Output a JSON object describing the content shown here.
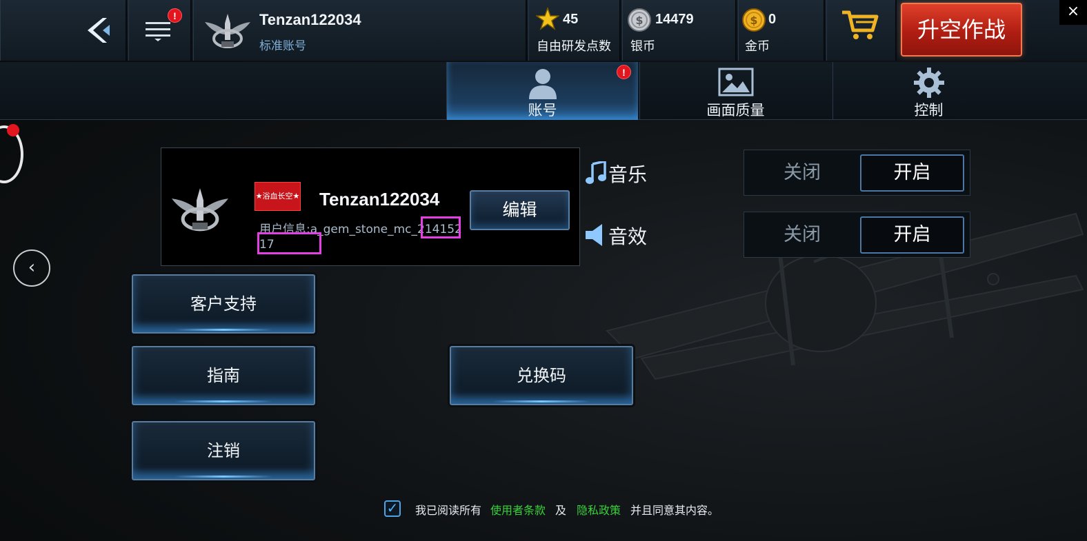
{
  "header": {
    "menu_badge": "!",
    "username": "Tenzan122034",
    "account_type": "标准账号",
    "research_points": {
      "value": "45",
      "label": "自由研发点数"
    },
    "silver": {
      "value": "14479",
      "label": "银币"
    },
    "gold": {
      "value": "0",
      "label": "金币"
    },
    "launch_button": "升空作战",
    "close": "×"
  },
  "tabs": [
    {
      "label": "账号",
      "badge": "!",
      "active": true
    },
    {
      "label": "画面质量",
      "active": false
    },
    {
      "label": "控制",
      "active": false
    }
  ],
  "profile": {
    "guild_tag": "★浴血长空★",
    "username": "Tenzan122034",
    "user_info": "用户信息:a_gem_stone_mc_21415217",
    "edit_button": "编辑"
  },
  "settings": {
    "music": {
      "label": "音乐",
      "off": "关闭",
      "on": "开启",
      "state": "on"
    },
    "sound_effects": {
      "label": "音效",
      "off": "关闭",
      "on": "开启",
      "state": "on"
    }
  },
  "buttons": {
    "support": "客户支持",
    "guide": "指南",
    "redeem": "兑换码",
    "logout": "注销"
  },
  "footer": {
    "checked": true,
    "text_before": "我已阅读所有",
    "terms_link": "使用者条款",
    "and": "及",
    "privacy_link": "隐私政策",
    "text_after": "并且同意其内容。"
  },
  "side": {
    "nav_arrow": "‹"
  },
  "colors": {
    "launch_red": "#c9291b",
    "link_green": "#38d13a",
    "badge_red": "#e3161f",
    "accent_blue": "#4fa4e8"
  }
}
